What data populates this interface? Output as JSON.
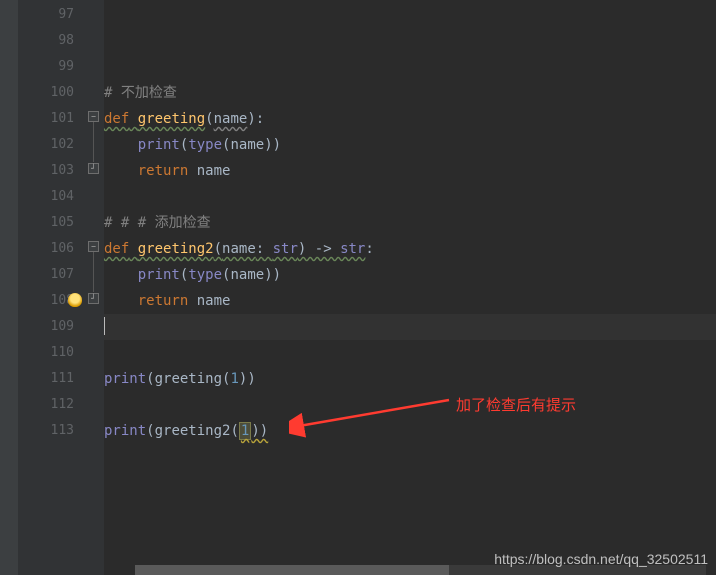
{
  "lines": {
    "start": 97,
    "end": 113
  },
  "code": {
    "l100_cmt": "# 不加检查",
    "l101_def": "def",
    "l101_fn": "greeting",
    "l101_param": "name",
    "l102_print": "print",
    "l102_type": "type",
    "l102_arg": "name",
    "l103_return": "return",
    "l103_val": "name",
    "l105_cmt": "# # # 添加检查",
    "l106_def": "def",
    "l106_fn": "greeting2",
    "l106_param": "name",
    "l106_ptype": "str",
    "l106_rtype": "str",
    "l107_print": "print",
    "l107_type": "type",
    "l107_arg": "name",
    "l108_return": "return",
    "l108_val": "name",
    "l111_print": "print",
    "l111_call": "greeting",
    "l111_arg": "1",
    "l113_print": "print",
    "l113_call": "greeting2",
    "l113_arg": "1"
  },
  "annotation": {
    "text": "加了检查后有提示"
  },
  "watermark": "https://blog.csdn.net/qq_32502511"
}
